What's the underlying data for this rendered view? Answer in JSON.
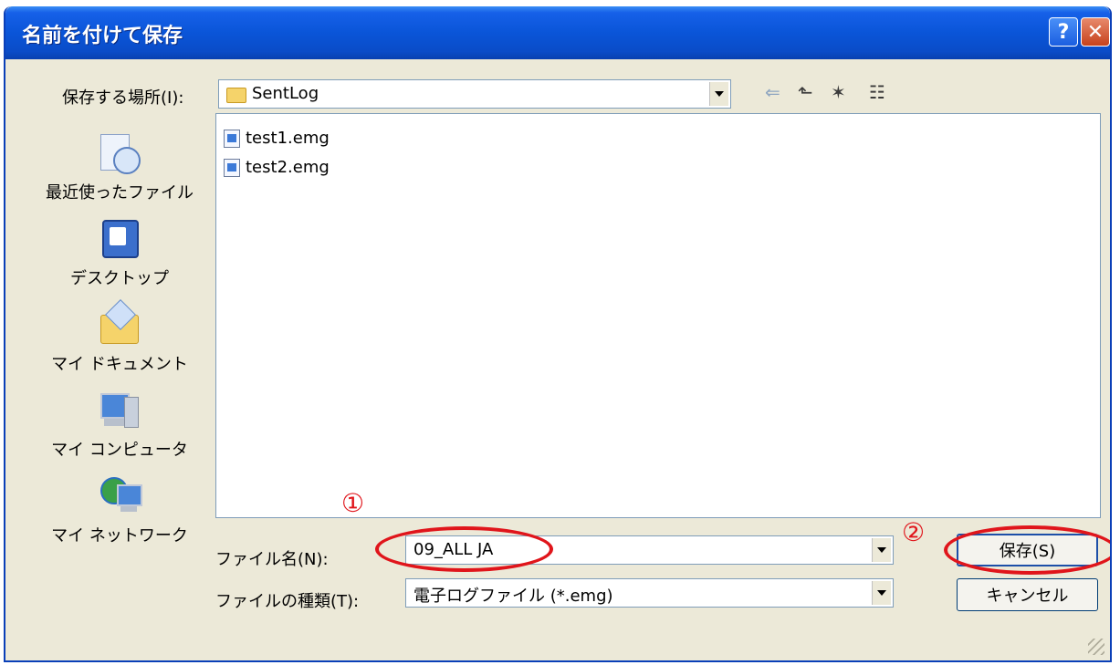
{
  "window": {
    "title": "名前を付けて保存"
  },
  "titlebar_buttons": {
    "help": "?",
    "close": "✕"
  },
  "location": {
    "label": "保存する場所(I):",
    "value": "SentLog"
  },
  "toolbar": {
    "back": "⇐",
    "up": "⬑",
    "new_folder": "✶",
    "views": "☷"
  },
  "places": [
    {
      "label": "最近使ったファイル",
      "icon": "recent-icon"
    },
    {
      "label": "デスクトップ",
      "icon": "desktop-icon"
    },
    {
      "label": "マイ ドキュメント",
      "icon": "documents-icon"
    },
    {
      "label": "マイ コンピュータ",
      "icon": "computer-icon"
    },
    {
      "label": "マイ ネットワーク",
      "icon": "network-icon"
    }
  ],
  "files": [
    {
      "name": "test1.emg"
    },
    {
      "name": "test2.emg"
    }
  ],
  "filename": {
    "label": "ファイル名(N):",
    "value": "09_ALL JA"
  },
  "filetype": {
    "label": "ファイルの種類(T):",
    "value": "電子ログファイル (*.emg)"
  },
  "buttons": {
    "save": "保存(S)",
    "cancel": "キャンセル"
  },
  "annotations": {
    "marker1": "①",
    "marker2": "②"
  }
}
